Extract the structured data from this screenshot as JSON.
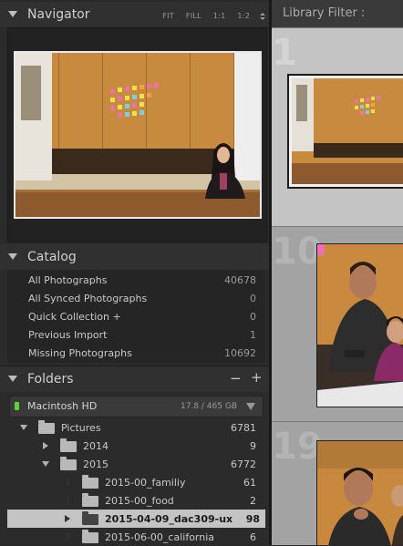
{
  "navigator": {
    "title": "Navigator",
    "zoom_options": [
      "FIT",
      "FILL",
      "1:1",
      "1:2"
    ]
  },
  "catalog": {
    "title": "Catalog",
    "items": [
      {
        "label": "All Photographs",
        "count": "40678"
      },
      {
        "label": "All Synced Photographs",
        "count": "0"
      },
      {
        "label": "Quick Collection +",
        "count": "0"
      },
      {
        "label": "Previous Import",
        "count": "1"
      },
      {
        "label": "Missing Photographs",
        "count": "10692"
      }
    ]
  },
  "folders": {
    "title": "Folders",
    "add_label": "+",
    "remove_label": "−",
    "volume": {
      "name": "Macintosh HD",
      "size": "17.8 / 465 GB"
    },
    "tree": [
      {
        "name": "Pictures",
        "count": "6781"
      },
      {
        "name": "2014",
        "count": "9"
      },
      {
        "name": "2015",
        "count": "6772"
      },
      {
        "name": "2015-00_familiy",
        "count": "61"
      },
      {
        "name": "2015-00_food",
        "count": "2"
      },
      {
        "name": "2015-04-09_dac309-ux",
        "count": "98"
      },
      {
        "name": "2015-06-00_california",
        "count": "6"
      }
    ]
  },
  "library_filter": {
    "label": "Library Filter :"
  },
  "grid": {
    "cell_numbers": [
      "1",
      "10",
      "19"
    ]
  },
  "colors": {
    "panel_bg": "#2b2b2b",
    "header_bg": "#303030",
    "selected_row": "#c4c4c4",
    "volume_led": "#5fcf3b",
    "grid_bg": "#a3a3a3"
  }
}
